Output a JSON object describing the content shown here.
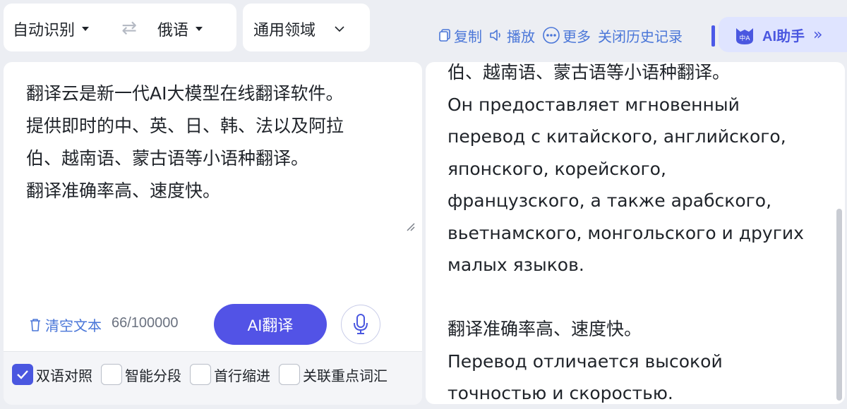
{
  "language_bar": {
    "source_lang": "自动识别",
    "target_lang": "俄语",
    "swap_icon": "⇄"
  },
  "domain": {
    "selected": "通用领域"
  },
  "toolbar": {
    "copy_label": "复制",
    "play_label": "播放",
    "more_label": "更多",
    "close_history_label": "关闭历史记录"
  },
  "ai_assistant": {
    "label": "AI助手",
    "avatar_text": "中A"
  },
  "source": {
    "lines": [
      "翻译云是新一代AI大模型在线翻译软件。",
      "提供即时的中、英、日、韩、法以及阿拉",
      "伯、越南语、蒙古语等小语种翻译。",
      "翻译准确率高、速度快。"
    ],
    "clear_label": "清空文本",
    "char_count": "66/100000",
    "translate_label": "AI翻译"
  },
  "options": [
    {
      "label": "双语对照",
      "checked": true
    },
    {
      "label": "智能分段",
      "checked": false
    },
    {
      "label": "首行缩进",
      "checked": false
    },
    {
      "label": "关联重点词汇",
      "checked": false
    }
  ],
  "target": {
    "clipped_line": "伯、越南语、蒙古语等小语种翻译。",
    "lines": [
      "Он предоставляет мгновенный",
      "перевод с китайского, английского,",
      "японского, корейского,",
      "французского, а также арабского,",
      "вьетнамского, монгольского и других",
      "малых языков.",
      "",
      "翻译准确率高、速度快。",
      "Перевод отличается высокой",
      "точностью и скоростью."
    ]
  },
  "colors": {
    "accent": "#5253e6",
    "link": "#4a76d8",
    "background": "#eceef3"
  }
}
